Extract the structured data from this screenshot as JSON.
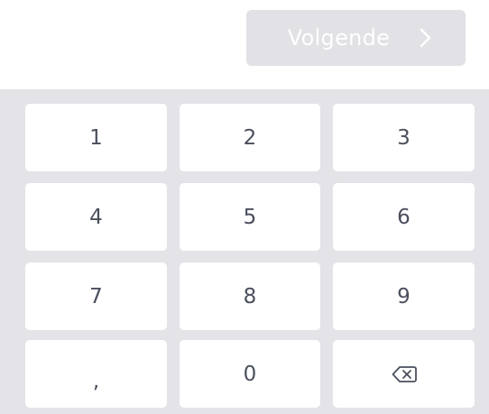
{
  "next_button": {
    "label": "Volgende",
    "icon": "chevron-right-icon",
    "enabled": false
  },
  "keypad": {
    "keys": [
      {
        "label": "1"
      },
      {
        "label": "2"
      },
      {
        "label": "3"
      },
      {
        "label": "4"
      },
      {
        "label": "5"
      },
      {
        "label": "6"
      },
      {
        "label": "7"
      },
      {
        "label": "8"
      },
      {
        "label": "9"
      },
      {
        "label": ","
      },
      {
        "label": "0"
      },
      {
        "label": "",
        "icon": "backspace-icon"
      }
    ]
  },
  "colors": {
    "keypad_background": "#e3e3e8",
    "key_background": "#ffffff",
    "key_text": "#4a4f5c",
    "button_disabled_background": "#e1e1e6",
    "button_text": "#ffffff"
  }
}
